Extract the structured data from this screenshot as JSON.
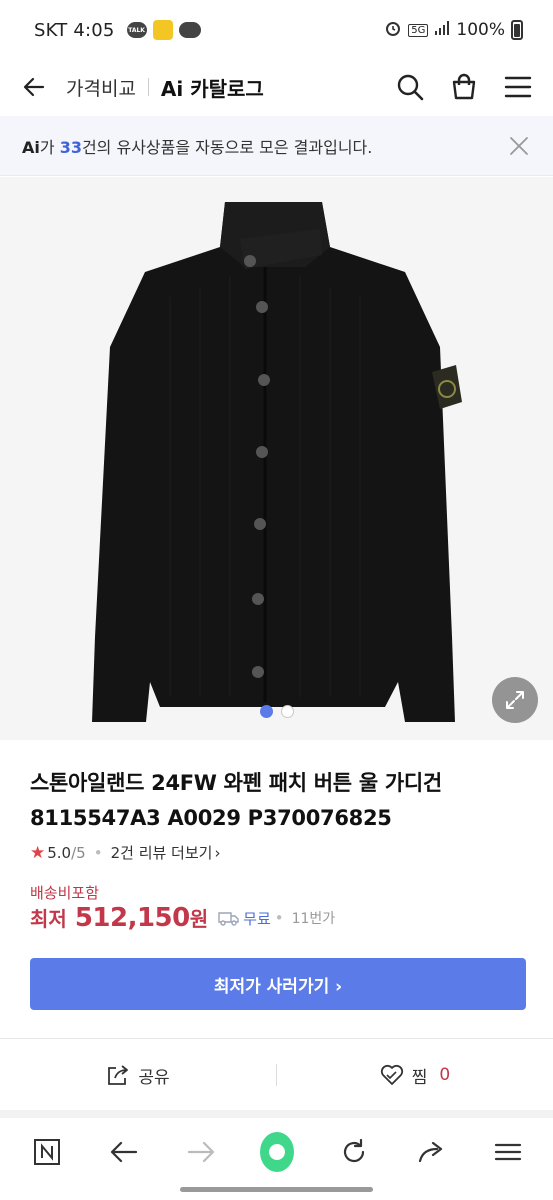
{
  "status_bar": {
    "carrier_time": "SKT 4:05",
    "talk_badge": "TALK",
    "network": "5G",
    "battery": "100%"
  },
  "nav": {
    "title_primary": "가격비교",
    "title_secondary": "Ai 카탈로그"
  },
  "ai_banner": {
    "logo": "Ai",
    "prefix": "가 ",
    "count": "33",
    "suffix": "건의 유사상품을 자동으로 모은 결과입니다."
  },
  "product": {
    "title": "스톤아일랜드 24FW 와펜 패치 버튼 울 가디건 8115547A3 A0029 P370076825",
    "rating": "5.0",
    "rating_max": "/5",
    "review_link": "2건 리뷰 더보기",
    "shipping_label": "배송비포함",
    "price_prefix": "최저",
    "price": "512,150",
    "price_unit": "원",
    "free_shipping": "무료",
    "seller_count": "11번가",
    "cta_label": "최저가 사러가기 ›"
  },
  "actions": {
    "share_label": "공유",
    "wish_label": "찜",
    "wish_count": "0"
  },
  "colors": {
    "accent_blue": "#5b7be8",
    "price_red": "#c2384a",
    "browser_green": "#3fd78a"
  },
  "icons": [
    "back-arrow",
    "search",
    "shopping-bag",
    "hamburger-menu",
    "close",
    "expand",
    "star",
    "truck",
    "share",
    "heart",
    "naver-n",
    "browser-back",
    "browser-forward",
    "naver-green-dot",
    "refresh",
    "browser-share",
    "browser-menu"
  ]
}
